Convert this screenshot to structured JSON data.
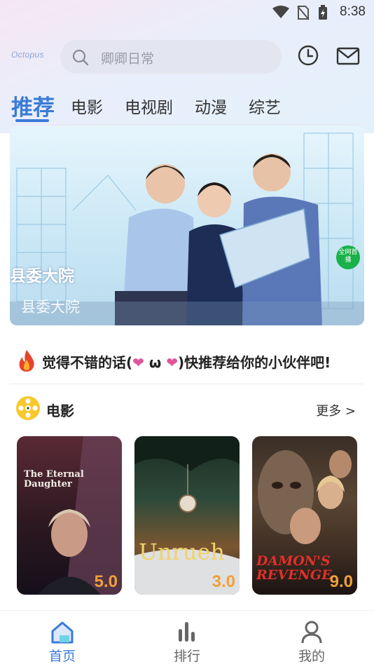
{
  "status_bar": {
    "time": "8:38",
    "icons": [
      "wifi-icon",
      "no-sim-icon",
      "battery-icon"
    ]
  },
  "header": {
    "logo_text": "Octopus",
    "search_placeholder": "卿卿日常",
    "icons": [
      "history-icon",
      "mail-icon"
    ]
  },
  "tabs": [
    {
      "label": "推荐",
      "active": true
    },
    {
      "label": "电影",
      "active": false
    },
    {
      "label": "电视剧",
      "active": false
    },
    {
      "label": "动漫",
      "active": false
    },
    {
      "label": "综艺",
      "active": false
    }
  ],
  "banner": {
    "title": "县委大院",
    "subtitle": "县委大院",
    "badge": "全网首播"
  },
  "promo": {
    "prefix": "觉得不错的话(",
    "heart1": "❤",
    "omega": " ω ",
    "heart2": "❤",
    "suffix": ")快推荐给你的小伙伴吧!"
  },
  "section": {
    "title": "电影",
    "more": "更多 >"
  },
  "posters": [
    {
      "title": "The Eternal Daughter",
      "score": "5.0"
    },
    {
      "title": "Unrueh",
      "score": "3.0"
    },
    {
      "title": "DAMON'S REVENGE",
      "score": "9.0"
    }
  ],
  "nav": [
    {
      "label": "首页",
      "active": true
    },
    {
      "label": "排行",
      "active": false
    },
    {
      "label": "我的",
      "active": false
    }
  ],
  "colors": {
    "accent": "#3b7bd6",
    "score": "#f0a03a",
    "heart": "#e0559a"
  }
}
